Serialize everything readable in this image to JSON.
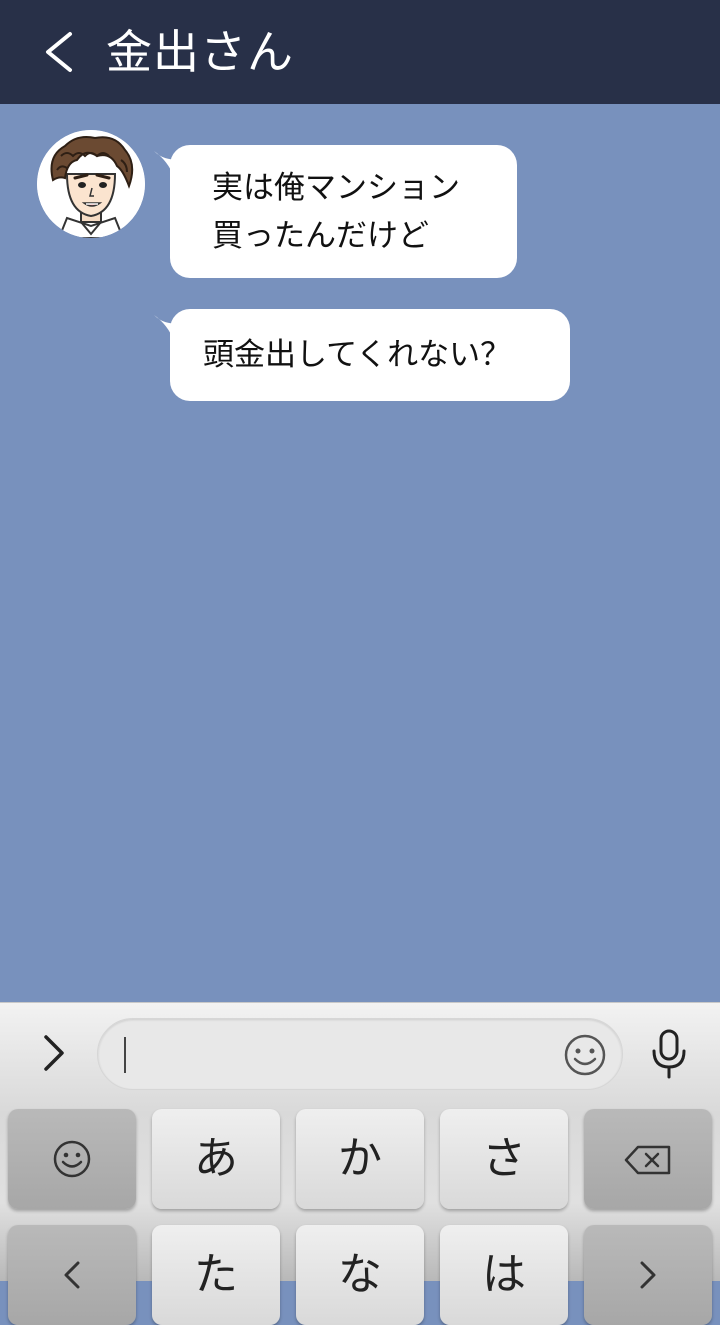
{
  "header": {
    "title": "金出さん",
    "bg_color": "#283048"
  },
  "chat": {
    "bg_color": "#7891bd",
    "messages": [
      {
        "lines": [
          "実は俺マンション",
          "買ったんだけど"
        ]
      },
      {
        "lines": [
          "頭金出してくれない？"
        ]
      }
    ]
  },
  "input": {
    "value": "",
    "placeholder": ""
  },
  "keyboard": {
    "row1": [
      {
        "icon": "emoji-icon"
      },
      {
        "label": "あ"
      },
      {
        "label": "か"
      },
      {
        "label": "さ"
      },
      {
        "icon": "backspace-icon"
      }
    ],
    "row2": [
      {
        "icon": "chevron-left-icon"
      },
      {
        "label": "た"
      },
      {
        "label": "な"
      },
      {
        "label": "は"
      },
      {
        "icon": "chevron-right-icon"
      }
    ]
  }
}
